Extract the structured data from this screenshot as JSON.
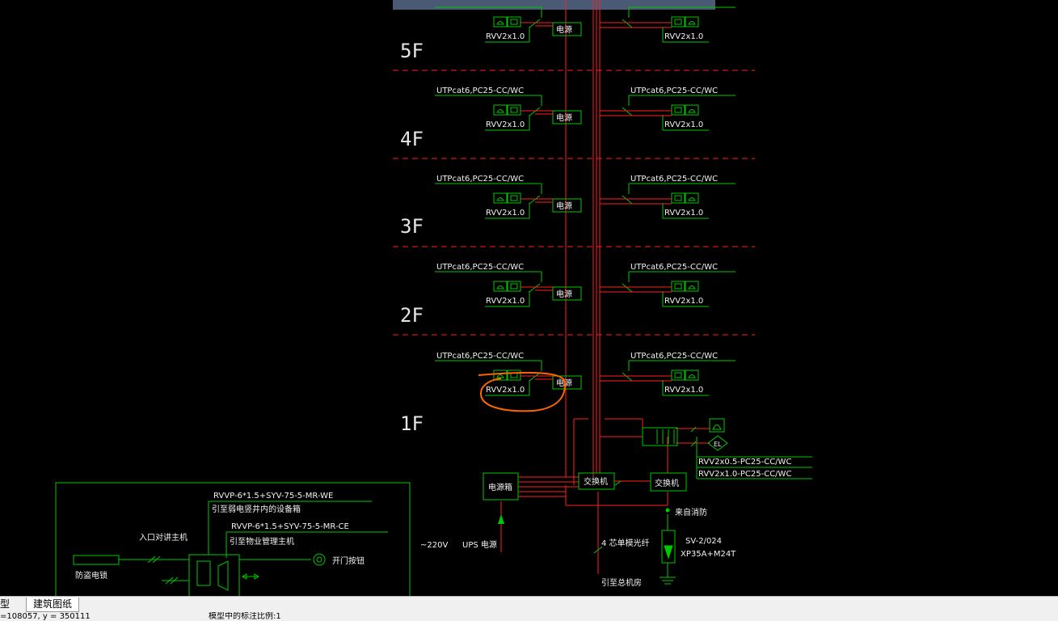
{
  "colors": {
    "background": "#000000",
    "wire": "#00c800",
    "riser": "#ff2020",
    "floor_divider": "#ff2020",
    "annotation": "#ff6600"
  },
  "floors": [
    "5F",
    "4F",
    "3F",
    "2F",
    "1F"
  ],
  "floor_tags": {
    "cable_spec": "UTPcat6,PC25-CC/WC",
    "power_wire": "RVV2x1.0",
    "power_box": "电源"
  },
  "equipment": {
    "power_cabinet": "电源箱",
    "switch_1": "交换机",
    "switch_2": "交换机",
    "ups_label": "UPS 电源",
    "voltage_label": "~220V",
    "fiber_label": "4 芯单模光纤",
    "fiber_to": "引至总机房",
    "from_fire": "来自消防",
    "fire_device": "SV-2/024",
    "fire_device_model": "XP35A+M24T",
    "el_label": "EL",
    "cable_1": "RVV2x0.5-PC25-CC/WC",
    "cable_2": "RVV2x1.0-PC25-CC/WC"
  },
  "entry_panel": {
    "cable_top": "RVVP-6*1.5+SYV-75-5-MR-WE",
    "cable_top_dest": "引至弱电竖井内的设备箱",
    "cable_mid": "RVVP-6*1.5+SYV-75-5-MR-CE",
    "cable_mid_dest": "引至物业管理主机",
    "entry_host": "入口对讲主机",
    "door_lock": "防盗电锁",
    "exit_button": "开门按钮"
  },
  "tabs": {
    "model_tab": "型",
    "layout_tab": "建筑图纸"
  },
  "status": {
    "coords": "=108057, y = 350111",
    "scale_label": "模型中的标注比例:1"
  }
}
